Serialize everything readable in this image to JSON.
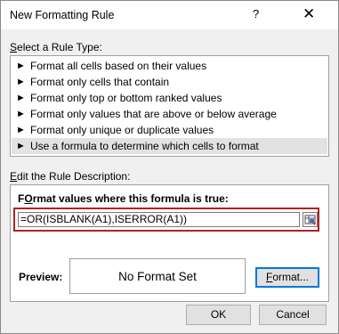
{
  "dialog": {
    "title": "New Formatting Rule",
    "help_label": "?",
    "close_label": "✕"
  },
  "rule_type": {
    "heading_accel": "S",
    "heading_rest": "elect a Rule Type:",
    "items": [
      {
        "label": "Format all cells based on their values",
        "selected": false
      },
      {
        "label": "Format only cells that contain",
        "selected": false
      },
      {
        "label": "Format only top or bottom ranked values",
        "selected": false
      },
      {
        "label": "Format only values that are above or below average",
        "selected": false
      },
      {
        "label": "Format only unique or duplicate values",
        "selected": false
      },
      {
        "label": "Use a formula to determine which cells to format",
        "selected": true
      }
    ]
  },
  "description": {
    "heading_accel": "E",
    "heading_rest": "dit the Rule Description:",
    "formula_label_accel": "O",
    "formula_label_pre": "F",
    "formula_label_rest": "rmat values where this formula is true:",
    "formula_value": "=OR(ISBLANK(A1),ISERROR(A1))",
    "preview_label": "Preview:",
    "preview_text": "No Format Set",
    "format_button_accel": "F",
    "format_button_rest": "ormat..."
  },
  "buttons": {
    "ok_label": "OK",
    "cancel_label": "Cancel"
  },
  "icons": {
    "rule_arrow": "arrow-right-icon",
    "collapse": "range-collapse-icon"
  },
  "colors": {
    "highlight_outline": "#b22222",
    "focus_border": "#0078d7",
    "selected_row": "#e2e2e2"
  }
}
